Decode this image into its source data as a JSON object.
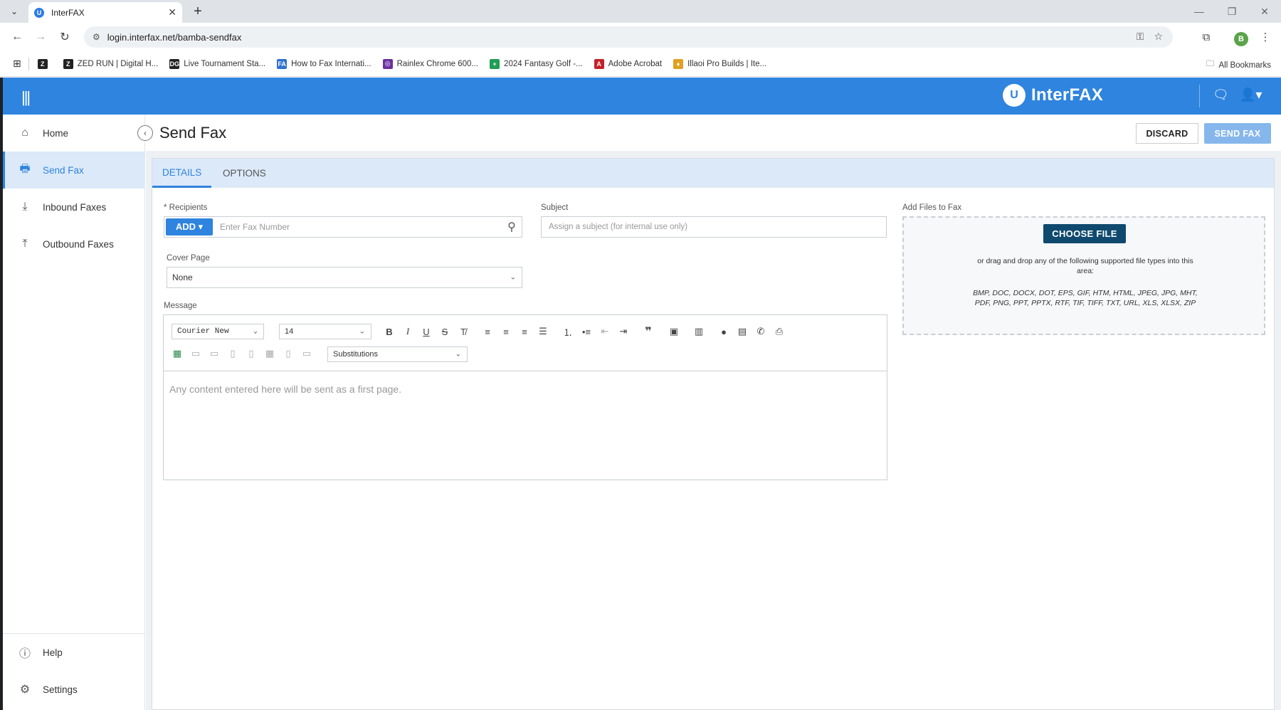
{
  "browser": {
    "tab_title": "InterFAX",
    "url": "login.interfax.net/bamba-sendfax",
    "profile_initial": "B",
    "bookmarks": [
      {
        "label": "",
        "icon": "Z",
        "color": "#222"
      },
      {
        "label": "ZED RUN | Digital H...",
        "icon": "Z",
        "color": "#222"
      },
      {
        "label": "Live Tournament Sta...",
        "icon": "DG",
        "color": "#222"
      },
      {
        "label": "How to Fax Internati...",
        "icon": "FA",
        "color": "#2e6fd1"
      },
      {
        "label": "Rainlex Chrome 600...",
        "icon": "◎",
        "color": "#6b2fa0"
      },
      {
        "label": "2024 Fantasy Golf -...",
        "icon": "+",
        "color": "#1f9d55"
      },
      {
        "label": "Adobe Acrobat",
        "icon": "A",
        "color": "#c3202a"
      },
      {
        "label": "Illaoi Pro Builds | Ite...",
        "icon": "♦",
        "color": "#e0a020"
      }
    ],
    "all_bookmarks": "All Bookmarks"
  },
  "app": {
    "logo_text": "InterFAX",
    "logo_mark": "U",
    "page_title": "Send Fax",
    "discard": "DISCARD",
    "send_fax": "SEND FAX",
    "sidebar": {
      "items": [
        {
          "label": "Home",
          "icon": "home-icon"
        },
        {
          "label": "Send Fax",
          "icon": "printer-icon"
        },
        {
          "label": "Inbound Faxes",
          "icon": "download-icon"
        },
        {
          "label": "Outbound Faxes",
          "icon": "upload-icon"
        }
      ],
      "bottom": [
        {
          "label": "Help",
          "icon": "help-icon"
        },
        {
          "label": "Settings",
          "icon": "gear-icon"
        }
      ]
    },
    "tabs": [
      {
        "label": "DETAILS"
      },
      {
        "label": "OPTIONS"
      }
    ],
    "form": {
      "recipients_label": "* Recipients",
      "add_label": "ADD ▾",
      "fax_placeholder": "Enter Fax Number",
      "subject_label": "Subject",
      "subject_placeholder": "Assign a subject (for internal use only)",
      "cover_label": "Cover Page",
      "cover_value": "None",
      "message_label": "Message",
      "font_value": "Courier New",
      "size_value": "14",
      "substitutions_value": "Substitutions",
      "editor_placeholder": "Any content entered here will be sent as a first page."
    },
    "files": {
      "label": "Add Files to Fax",
      "choose": "CHOOSE FILE",
      "drag_text": "or drag and drop any of the following supported file types into this area:",
      "types": "BMP, DOC, DOCX, DOT, EPS, GIF, HTM, HTML, JPEG, JPG, MHT, PDF, PNG, PPT, PPTX, RTF, TIF, TIFF, TXT, URL, XLS, XLSX, ZIP"
    }
  }
}
